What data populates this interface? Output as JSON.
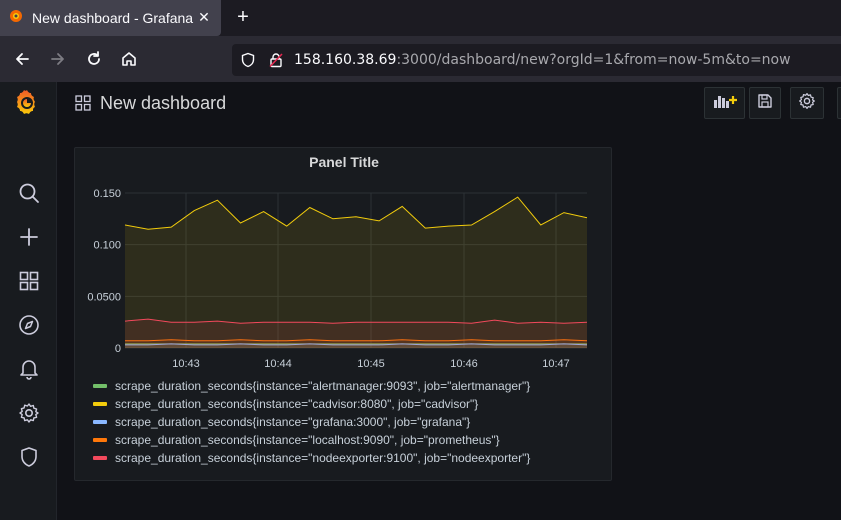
{
  "browser": {
    "tab_title": "New dashboard - Grafana",
    "tab_close": "✕",
    "new_tab": "+",
    "url_host": "158.160.38.69",
    "url_rest": ":3000/dashboard/new?orgId=1&from=now-5m&to=now"
  },
  "sidebar": {
    "items": [
      "grafana-logo",
      "search-icon",
      "plus-icon",
      "dashboards-icon",
      "explore-icon",
      "alerting-icon",
      "settings-icon",
      "shield-icon"
    ]
  },
  "header": {
    "title": "New dashboard"
  },
  "colors": {
    "alertmanager": "#73bf69",
    "cadvisor": "#f2cc0c",
    "grafana": "#8ab8ff",
    "prometheus": "#ff780a",
    "nodeexporter": "#f2495c"
  },
  "panel": {
    "title": "Panel Title"
  },
  "chart_data": {
    "type": "area",
    "title": "Panel Title",
    "xlabel": "",
    "ylabel": "",
    "x_ticks": [
      "10:43",
      "10:44",
      "10:45",
      "10:46",
      "10:47"
    ],
    "y_ticks": [
      "0",
      "0.0500",
      "0.100",
      "0.150"
    ],
    "ylim": [
      0,
      0.15
    ],
    "grid": true,
    "legend_position": "bottom",
    "series": [
      {
        "name": "scrape_duration_seconds{instance=\"alertmanager:9093\", job=\"alertmanager\"}",
        "color": "#73bf69",
        "values": [
          0.004,
          0.004,
          0.004,
          0.004,
          0.004,
          0.004,
          0.004,
          0.004,
          0.004,
          0.004,
          0.004,
          0.004,
          0.004,
          0.004,
          0.004,
          0.004,
          0.004,
          0.004,
          0.004,
          0.004,
          0.004,
          0.004,
          0.004,
          0.004,
          0.004,
          0.004
        ]
      },
      {
        "name": "scrape_duration_seconds{instance=\"cadvisor:8080\", job=\"cadvisor\"}",
        "color": "#f2cc0c",
        "values": [
          0.119,
          0.115,
          0.117,
          0.133,
          0.143,
          0.121,
          0.132,
          0.118,
          0.136,
          0.125,
          0.127,
          0.123,
          0.137,
          0.116,
          0.118,
          0.119,
          0.132,
          0.146,
          0.119,
          0.131,
          0.126
        ]
      },
      {
        "name": "scrape_duration_seconds{instance=\"grafana:3000\", job=\"grafana\"}",
        "color": "#8ab8ff",
        "values": [
          0.003,
          0.003,
          0.004,
          0.003,
          0.003,
          0.004,
          0.003,
          0.003,
          0.004,
          0.003,
          0.003,
          0.003,
          0.004,
          0.003,
          0.003,
          0.004,
          0.003,
          0.003,
          0.003,
          0.004,
          0.003
        ]
      },
      {
        "name": "scrape_duration_seconds{instance=\"localhost:9090\", job=\"prometheus\"}",
        "color": "#ff780a",
        "values": [
          0.007,
          0.007,
          0.008,
          0.007,
          0.007,
          0.008,
          0.007,
          0.007,
          0.008,
          0.007,
          0.007,
          0.007,
          0.008,
          0.007,
          0.007,
          0.008,
          0.007,
          0.007,
          0.007,
          0.008,
          0.007
        ]
      },
      {
        "name": "scrape_duration_seconds{instance=\"nodeexporter:9100\", job=\"nodeexporter\"}",
        "color": "#f2495c",
        "values": [
          0.026,
          0.028,
          0.025,
          0.025,
          0.026,
          0.024,
          0.025,
          0.025,
          0.025,
          0.024,
          0.025,
          0.025,
          0.025,
          0.025,
          0.025,
          0.024,
          0.027,
          0.024,
          0.025,
          0.024,
          0.025
        ]
      }
    ]
  }
}
